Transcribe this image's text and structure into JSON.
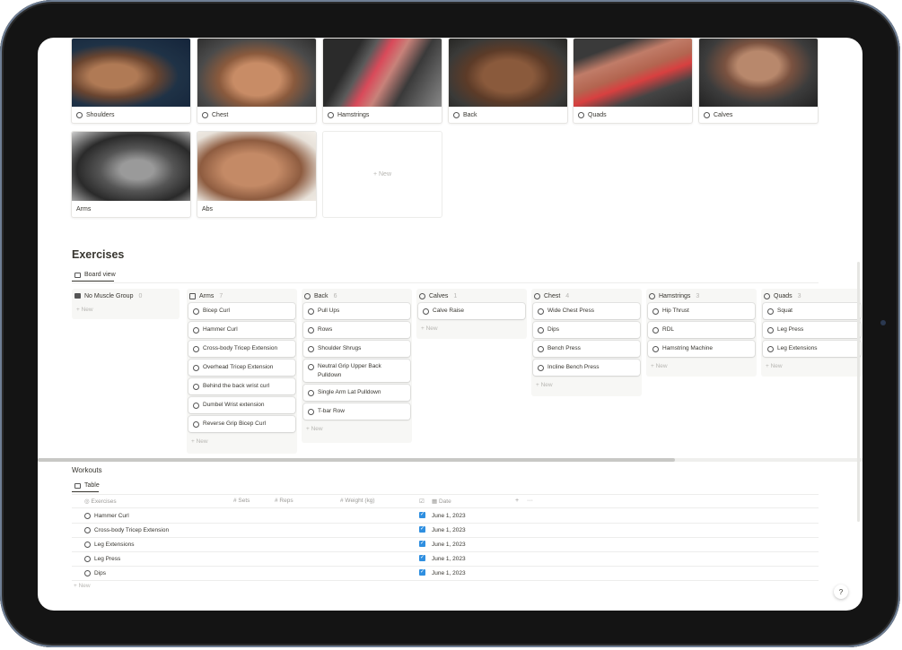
{
  "gallery": {
    "cards": [
      {
        "label": "Shoulders",
        "icon": "circle-icon"
      },
      {
        "label": "Chest",
        "icon": "circle-icon"
      },
      {
        "label": "Hamstrings",
        "icon": "circle-icon"
      },
      {
        "label": "Back",
        "icon": "circle-icon"
      },
      {
        "label": "Quads",
        "icon": "circle-icon"
      },
      {
        "label": "Calves",
        "icon": "circle-icon"
      },
      {
        "label": "Arms",
        "icon": ""
      },
      {
        "label": "Abs",
        "icon": ""
      }
    ],
    "new_label": "+ New"
  },
  "exercises": {
    "title": "Exercises",
    "view_tab": "Board view",
    "columns": [
      {
        "name": "No Muscle Group",
        "count": "0",
        "items": [],
        "new": "+ New"
      },
      {
        "name": "Arms",
        "count": "7",
        "items": [
          "Bicep Curl",
          "Hammer Curl",
          "Cross-body Tricep Extension",
          "Overhead Tricep Extension",
          "Behind the back wrist curl",
          "Dumbel Wrist extension",
          "Reverse Grip Bicep Curl"
        ],
        "new": "+ New"
      },
      {
        "name": "Back",
        "count": "6",
        "items": [
          "Pull Ups",
          "Rows",
          "Shoulder Shrugs",
          "Neutral Grip Upper Back Pulldown",
          "Single Arm Lat Pulldown",
          "T-bar Row"
        ],
        "new": "+ New"
      },
      {
        "name": "Calves",
        "count": "1",
        "items": [
          "Calve Raise"
        ],
        "new": "+ New"
      },
      {
        "name": "Chest",
        "count": "4",
        "items": [
          "Wide Chest Press",
          "Dips",
          "Bench Press",
          "Incline Bench Press"
        ],
        "new": "+ New"
      },
      {
        "name": "Hamstrings",
        "count": "3",
        "items": [
          "Hip Thrust",
          "RDL",
          "Hamstring Machine"
        ],
        "new": "+ New"
      },
      {
        "name": "Quads",
        "count": "3",
        "items": [
          "Squat",
          "Leg Press",
          "Leg Extensions"
        ],
        "new": "+ New"
      }
    ]
  },
  "workouts": {
    "title": "Workouts",
    "view_tab": "Table",
    "headers": {
      "exercises": "Exercises",
      "sets": "Sets",
      "reps": "Reps",
      "weight": "Weight (kg)",
      "date": "Date",
      "plus": "+",
      "more": "···"
    },
    "rows": [
      {
        "name": "Hammer Curl",
        "done": true,
        "date": "June 1, 2023"
      },
      {
        "name": "Cross-body Tricep Extension",
        "done": true,
        "date": "June 1, 2023"
      },
      {
        "name": "Leg Extensions",
        "done": true,
        "date": "June 1, 2023"
      },
      {
        "name": "Leg Press",
        "done": true,
        "date": "June 1, 2023"
      },
      {
        "name": "Dips",
        "done": true,
        "date": "June 1, 2023"
      }
    ],
    "new_label": "+ New"
  },
  "help_label": "?",
  "colors": {
    "checkbox": "#2f8fe0",
    "text": "#37352f",
    "muted": "#9b9a97",
    "bezel": "#141414"
  }
}
